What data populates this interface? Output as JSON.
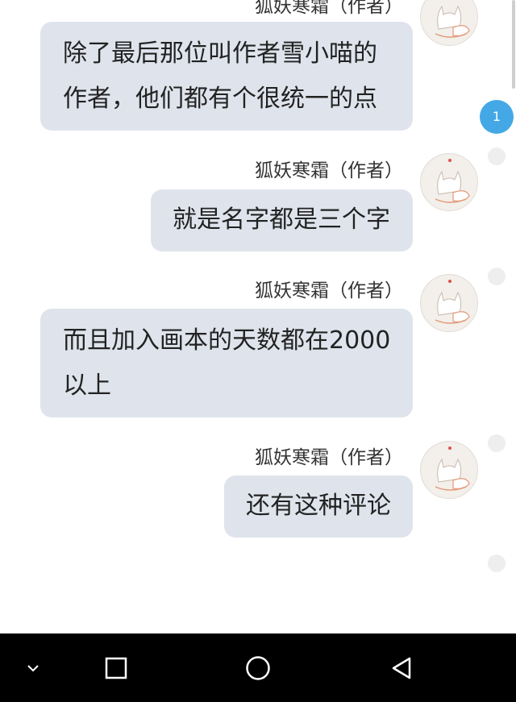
{
  "messages": [
    {
      "sender": "狐妖寒霜（作者）",
      "lines": [
        "除了最后那位叫作者雪小喵的",
        "作者，他们都有个很统一的点"
      ]
    },
    {
      "sender": "狐妖寒霜（作者）",
      "lines": [
        "就是名字都是三个字"
      ]
    },
    {
      "sender": "狐妖寒霜（作者）",
      "lines": [
        "而且加入画本的天数都在2000",
        "以上"
      ]
    },
    {
      "sender": "狐妖寒霜（作者）",
      "lines": [
        "还有这种评论"
      ]
    }
  ],
  "unread_badge": "1",
  "icons": {
    "avatar": "fox-avatar-icon",
    "nav_collapse": "chevron-down-icon",
    "nav_recents": "square-icon",
    "nav_home": "circle-icon",
    "nav_back": "triangle-back-icon"
  },
  "colors": {
    "bubble": "#dfe4ec",
    "badge": "#44a8e6",
    "navbar": "#000000"
  }
}
